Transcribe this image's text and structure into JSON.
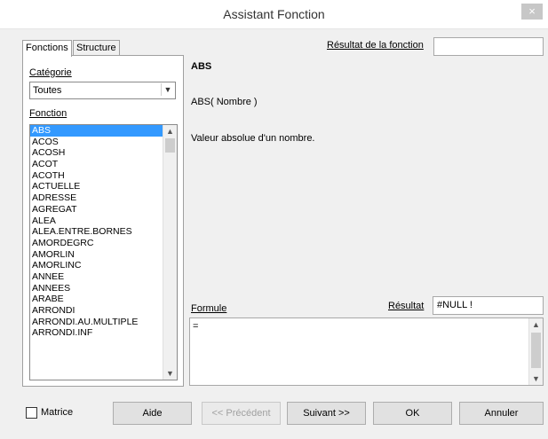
{
  "window": {
    "title": "Assistant Fonction",
    "close_glyph": "×"
  },
  "tabs": [
    {
      "label": "Fonctions"
    },
    {
      "label": "Structure"
    }
  ],
  "category": {
    "label": "Catégorie",
    "value": "Toutes"
  },
  "function_list": {
    "label": "Fonction",
    "items": [
      "ABS",
      "ACOS",
      "ACOSH",
      "ACOT",
      "ACOTH",
      "ACTUELLE",
      "ADRESSE",
      "AGREGAT",
      "ALEA",
      "ALEA.ENTRE.BORNES",
      "AMORDEGRC",
      "AMORLIN",
      "AMORLINC",
      "ANNEE",
      "ANNEES",
      "ARABE",
      "ARRONDI",
      "ARRONDI.AU.MULTIPLE",
      "ARRONDI.INF"
    ],
    "selected": "ABS"
  },
  "function_result": {
    "label": "Résultat de la fonction",
    "value": ""
  },
  "function_info": {
    "name": "ABS",
    "syntax": "ABS( Nombre )",
    "description": "Valeur absolue d'un nombre."
  },
  "formula": {
    "label": "Formule",
    "value": "="
  },
  "result": {
    "label": "Résultat",
    "value": "#NULL !"
  },
  "buttons": {
    "matrix": "Matrice",
    "help": "Aide",
    "previous": "<< Précédent",
    "next": "Suivant >>",
    "ok": "OK",
    "cancel": "Annuler"
  }
}
